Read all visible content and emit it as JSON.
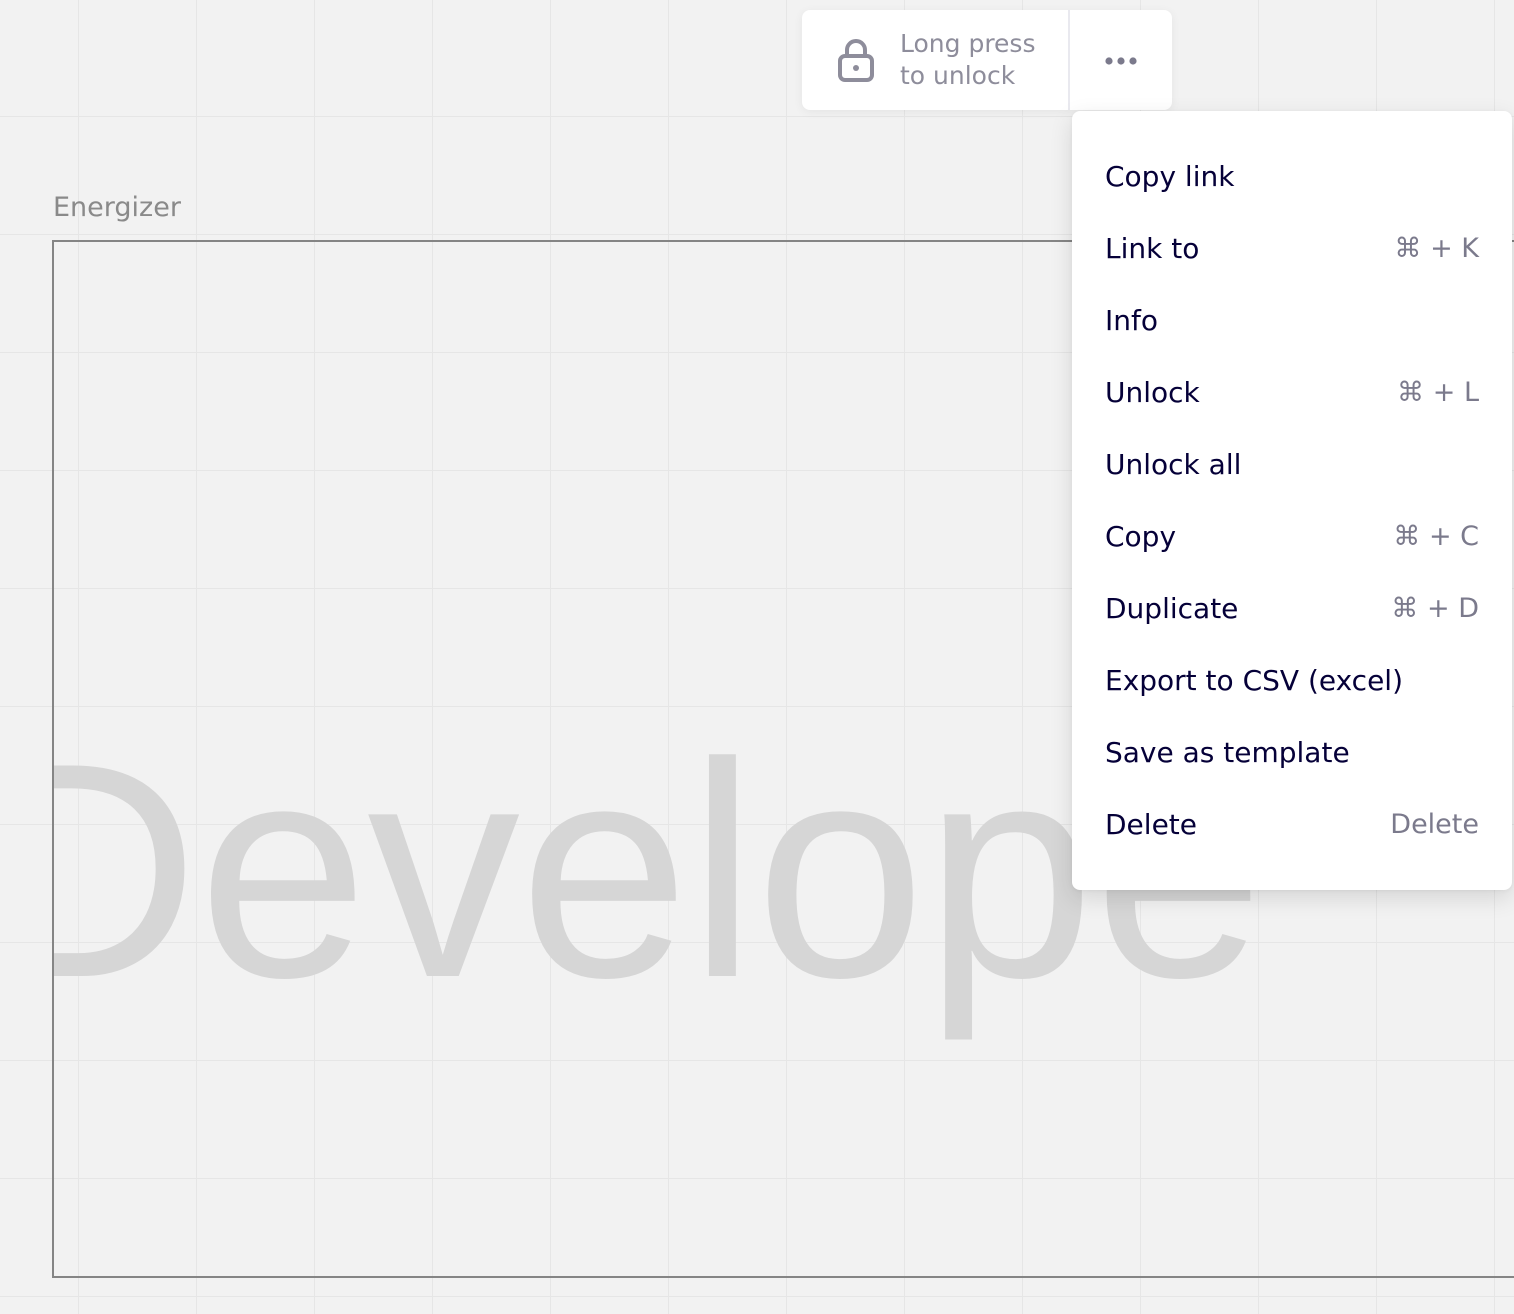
{
  "frame": {
    "title": "Energizer",
    "big_text": "Develope"
  },
  "lock_toolbar": {
    "icon": "lock-icon",
    "unlock_line1": "Long press",
    "unlock_line2": "to unlock",
    "more_icon": "more-horizontal-icon"
  },
  "context_menu": {
    "items": [
      {
        "label": "Copy link",
        "shortcut": ""
      },
      {
        "label": "Link to",
        "shortcut": "⌘ + K"
      },
      {
        "label": "Info",
        "shortcut": ""
      },
      {
        "label": "Unlock",
        "shortcut": "⌘ + L"
      },
      {
        "label": "Unlock all",
        "shortcut": ""
      },
      {
        "label": "Copy",
        "shortcut": "⌘ + C"
      },
      {
        "label": "Duplicate",
        "shortcut": "⌘ + D"
      },
      {
        "label": "Export to CSV (excel)",
        "shortcut": ""
      },
      {
        "label": "Save as template",
        "shortcut": ""
      },
      {
        "label": "Delete",
        "shortcut": "Delete"
      }
    ]
  },
  "colors": {
    "canvas_bg": "#f2f2f2",
    "grid_line": "#e6e6e6",
    "menu_text": "#050038",
    "muted_text": "#8e8d9b"
  }
}
